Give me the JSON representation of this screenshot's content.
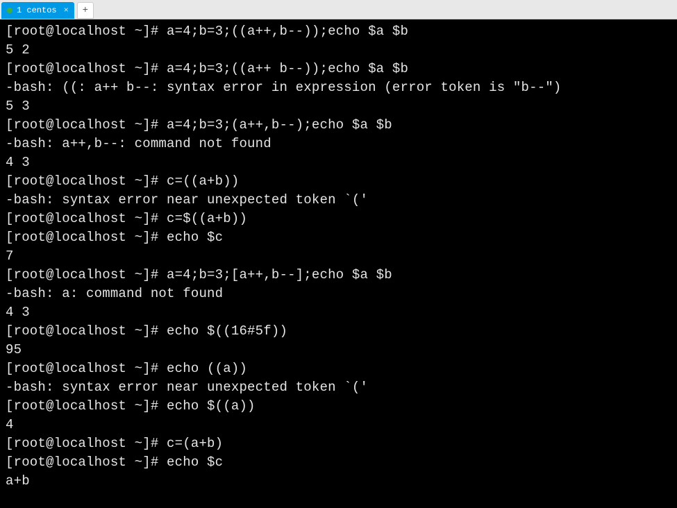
{
  "tab": {
    "label": "1 centos",
    "close_symbol": "×"
  },
  "add_tab_symbol": "+",
  "prompt": "[root@localhost ~]# ",
  "lines": [
    {
      "type": "cmd",
      "text": "a=4;b=3;((a++,b--));echo $a $b"
    },
    {
      "type": "out",
      "text": "5 2"
    },
    {
      "type": "cmd",
      "text": "a=4;b=3;((a++ b--));echo $a $b"
    },
    {
      "type": "out",
      "text": "-bash: ((: a++ b--: syntax error in expression (error token is \"b--\")"
    },
    {
      "type": "out",
      "text": "5 3"
    },
    {
      "type": "cmd",
      "text": "a=4;b=3;(a++,b--);echo $a $b"
    },
    {
      "type": "out",
      "text": "-bash: a++,b--: command not found"
    },
    {
      "type": "out",
      "text": "4 3"
    },
    {
      "type": "cmd",
      "text": "c=((a+b))"
    },
    {
      "type": "out",
      "text": "-bash: syntax error near unexpected token `('"
    },
    {
      "type": "cmd",
      "text": "c=$((a+b))"
    },
    {
      "type": "cmd",
      "text": "echo $c"
    },
    {
      "type": "out",
      "text": "7"
    },
    {
      "type": "cmd",
      "text": "a=4;b=3;[a++,b--];echo $a $b"
    },
    {
      "type": "out",
      "text": "-bash: a: command not found"
    },
    {
      "type": "out",
      "text": "4 3"
    },
    {
      "type": "cmd",
      "text": "echo $((16#5f))"
    },
    {
      "type": "out",
      "text": "95"
    },
    {
      "type": "cmd",
      "text": "echo ((a))"
    },
    {
      "type": "out",
      "text": "-bash: syntax error near unexpected token `('"
    },
    {
      "type": "cmd",
      "text": "echo $((a))"
    },
    {
      "type": "out",
      "text": "4"
    },
    {
      "type": "cmd",
      "text": "c=(a+b)"
    },
    {
      "type": "cmd",
      "text": "echo $c"
    },
    {
      "type": "out",
      "text": "a+b"
    }
  ]
}
